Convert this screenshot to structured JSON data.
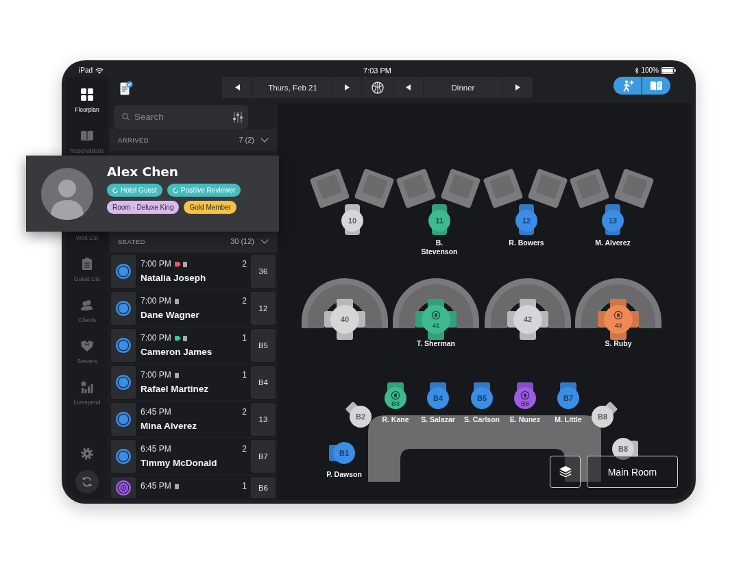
{
  "status_bar": {
    "device": "iPad",
    "time": "7:03 PM",
    "battery": "100%"
  },
  "nav": [
    {
      "label": "Floorplan",
      "selected": true,
      "kind": "grid"
    },
    {
      "label": "Reservations",
      "selected": false,
      "kind": "book"
    },
    {
      "label": "Wait List",
      "selected": false
    },
    {
      "label": "Guest List",
      "selected": false,
      "kind": "clipboard"
    },
    {
      "label": "Clients",
      "selected": false,
      "kind": "people"
    },
    {
      "label": "Servers",
      "selected": false,
      "kind": "tuxedo"
    },
    {
      "label": "Livespend",
      "selected": false,
      "kind": "chart"
    }
  ],
  "toolbar": {
    "date": "Thurs, Feb 21",
    "shift": "Dinner"
  },
  "search": {
    "placeholder": "Search"
  },
  "sections": [
    {
      "label": "ARRIVED",
      "count": "7 (2)"
    },
    {
      "label": "SEATED",
      "count": "30 (12)",
      "rows": [
        {
          "time": "7:00 PM",
          "name": "Natalia Joseph",
          "party": "2",
          "table": "36",
          "color": "#3a8ee6",
          "marked": false,
          "icons": [
            {
              "kind": "tag",
              "color": "#e8566f"
            },
            {
              "kind": "note"
            }
          ]
        },
        {
          "time": "7:00 PM",
          "name": "Dane Wagner",
          "party": "2",
          "table": "12",
          "color": "#3a8ee6",
          "marked": false,
          "icons": [
            {
              "kind": "note"
            }
          ]
        },
        {
          "time": "7:00 PM",
          "name": "Cameron James",
          "party": "1",
          "table": "B5",
          "color": "#3a8ee6",
          "marked": false,
          "icons": [
            {
              "kind": "tag",
              "color": "#35c8aa"
            },
            {
              "kind": "note"
            }
          ]
        },
        {
          "time": "7:00 PM",
          "name": "Rafael Martinez",
          "party": "1",
          "table": "B4",
          "color": "#3a8ee6",
          "marked": false,
          "icons": [
            {
              "kind": "note"
            }
          ]
        },
        {
          "time": "6:45 PM",
          "name": "Mina Alverez",
          "party": "2",
          "table": "13",
          "color": "#3a8ee6",
          "marked": false
        },
        {
          "time": "6:45 PM",
          "name": "Timmy McDonald",
          "party": "2",
          "table": "B7",
          "color": "#3a8ee6",
          "marked": false
        },
        {
          "time": "6:45 PM",
          "party": "1",
          "table": "B6",
          "color": "#9b5de5",
          "marked": true,
          "icons": [
            {
              "kind": "note"
            }
          ]
        }
      ]
    }
  ],
  "guest_card": {
    "name": "Alex Chen",
    "tags": [
      {
        "label": "Hotel Guest",
        "color": "#45bdbf",
        "icon": true
      },
      {
        "label": "Positive Reviewer",
        "color": "#45bdbf",
        "icon": true
      },
      {
        "label": "Room - Deluxe King",
        "color": "#d9b9ee",
        "icon": false
      },
      {
        "label": "Gold Member",
        "color": "#f6c343",
        "icon": false
      }
    ]
  },
  "floor": {
    "tables": [
      {
        "number": "10",
        "kind": "round",
        "color": "#d6d6d8",
        "marked": false
      },
      {
        "number": "11",
        "kind": "round",
        "color": "#3dba8f",
        "guest": "B. Stevenson",
        "marked": false
      },
      {
        "number": "12",
        "kind": "round",
        "color": "#3a8ee6",
        "guest": "R. Bowers",
        "marked": false
      },
      {
        "number": "13",
        "kind": "round",
        "color": "#3a8ee6",
        "guest": "M. Alverez",
        "marked": false
      },
      {
        "number": "40",
        "kind": "booth",
        "color": "#d6d6d8",
        "marked": false
      },
      {
        "number": "41",
        "kind": "booth",
        "color": "#3dba8f",
        "guest": "T. Sherman",
        "marked": true
      },
      {
        "number": "42",
        "kind": "booth",
        "color": "#d6d6d8",
        "marked": false
      },
      {
        "number": "43",
        "kind": "booth",
        "color": "#ee8a56",
        "guest": "S. Ruby",
        "marked": true
      },
      {
        "number": "B2",
        "kind": "stool",
        "color": "#d6d6d8",
        "marked": false
      },
      {
        "number": "B3",
        "kind": "stool",
        "color": "#3dba8f",
        "guest": "R. Kane",
        "marked": true
      },
      {
        "number": "B4",
        "kind": "stool",
        "color": "#3a8ee6",
        "guest": "S. Salazar",
        "marked": false
      },
      {
        "number": "B5",
        "kind": "stool",
        "color": "#3a8ee6",
        "guest": "S. Carlson",
        "marked": false
      },
      {
        "number": "B6",
        "kind": "stool",
        "color": "#9b5de5",
        "guest": "E. Nunez",
        "marked": true
      },
      {
        "number": "B7",
        "kind": "stool",
        "color": "#3a8ee6",
        "guest": "M. Little",
        "marked": false
      },
      {
        "number": "B8",
        "kind": "stool",
        "color": "#d6d6d8",
        "marked": false
      },
      {
        "number": "B1",
        "kind": "stool",
        "color": "#3a8ee6",
        "guest": "P. Dawson",
        "marked": false
      },
      {
        "number": "B8",
        "kind": "stool",
        "color": "#d6d6d8",
        "marked": false
      }
    ],
    "room": "Main Room"
  }
}
